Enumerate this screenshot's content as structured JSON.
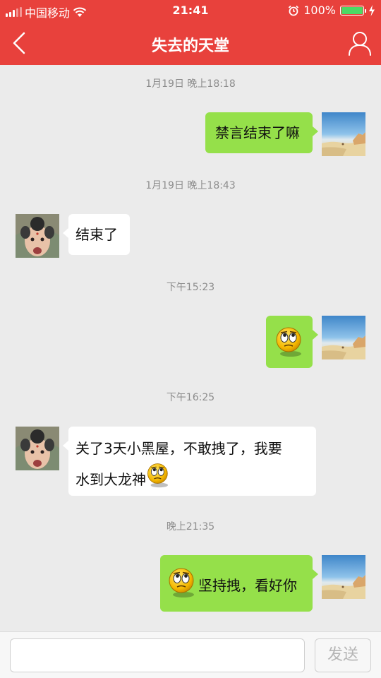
{
  "status_bar": {
    "carrier": "中国移动",
    "time": "21:41",
    "battery_percent": "100%",
    "battery_level": 1.0,
    "icons": [
      "signal-icon",
      "wifi-icon",
      "alarm-icon",
      "battery-icon",
      "charging-icon"
    ]
  },
  "header": {
    "title": "失去的天堂",
    "back_icon": "chevron-left-icon",
    "profile_icon": "user-icon",
    "background": "#e8413c"
  },
  "messages": [
    {
      "type": "timestamp",
      "text": "1月19日 晚上18:18"
    },
    {
      "type": "message",
      "sender": "me",
      "text": "禁言结束了嘛"
    },
    {
      "type": "timestamp",
      "text": "1月19日 晚上18:43"
    },
    {
      "type": "message",
      "sender": "them",
      "text": "结束了"
    },
    {
      "type": "timestamp",
      "text": "下午15:23"
    },
    {
      "type": "message",
      "sender": "me",
      "text": "",
      "emoji": "rolling-eyes-emoji"
    },
    {
      "type": "timestamp",
      "text": "下午16:25"
    },
    {
      "type": "message",
      "sender": "them",
      "line1": "关了3天小黑屋，不敢拽了，我要",
      "line2": "水到大龙神",
      "emoji": "rolling-eyes-emoji"
    },
    {
      "type": "timestamp",
      "text": "晚上21:35"
    },
    {
      "type": "message",
      "sender": "me",
      "text": "坚持拽，看好你",
      "emoji": "rolling-eyes-emoji"
    }
  ],
  "input_bar": {
    "placeholder": "",
    "send_label": "发送"
  },
  "colors": {
    "my_bubble": "#95e04a",
    "their_bubble": "#ffffff",
    "chat_background": "#ebebeb",
    "accent": "#e8413c"
  }
}
